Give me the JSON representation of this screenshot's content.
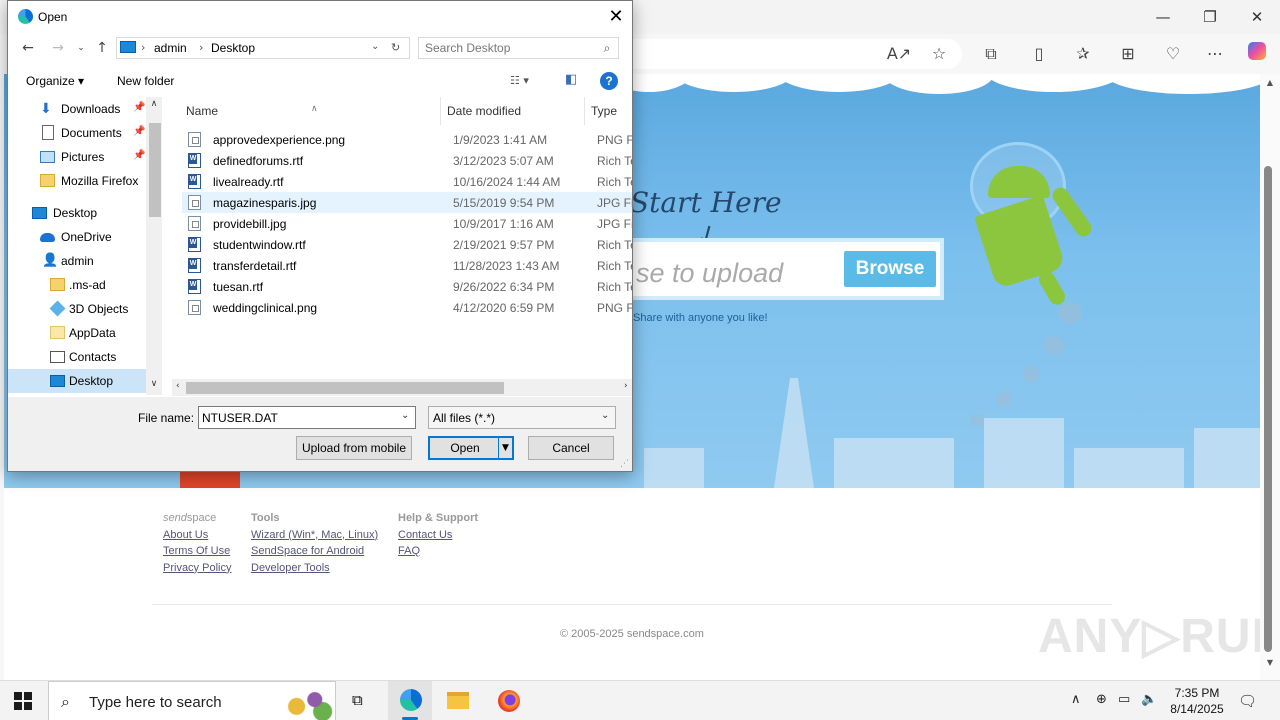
{
  "browser": {
    "window_controls": {
      "minimize": "—",
      "restore": "❐",
      "close": "✕"
    },
    "toolbar_icons": [
      "read-aloud-icon",
      "favorite-icon",
      "extensions-icon",
      "split-screen-icon",
      "favorites-icon",
      "collections-icon",
      "browser-essentials-icon",
      "more-icon",
      "copilot-icon"
    ]
  },
  "page": {
    "start_here": "Start Here",
    "upload_placeholder": "se to upload",
    "browse_label": "Browse",
    "share_text": "Share with anyone you like!",
    "footer": {
      "brand": {
        "head_a": "send",
        "head_b": "space",
        "links": [
          "About Us",
          "Terms Of Use",
          "Privacy Policy"
        ]
      },
      "tools": {
        "head": "Tools",
        "links": [
          "Wizard (Win*, Mac, Linux)",
          "SendSpace for Android",
          "Developer Tools"
        ]
      },
      "help": {
        "head": "Help & Support",
        "links": [
          "Contact Us",
          "FAQ"
        ]
      },
      "copyright": "© 2005-2025 sendspace.com"
    },
    "watermark": "ANY▷RUN"
  },
  "dialog": {
    "title": "Open",
    "breadcrumb": [
      "admin",
      "Desktop"
    ],
    "search_placeholder": "Search Desktop",
    "organize_label": "Organize ▾",
    "new_folder_label": "New folder",
    "nav_items": [
      {
        "label": "Downloads",
        "icon": "download-arrow-icon",
        "pinned": true
      },
      {
        "label": "Documents",
        "icon": "documents-icon",
        "pinned": true
      },
      {
        "label": "Pictures",
        "icon": "pictures-icon",
        "pinned": true
      },
      {
        "label": "Mozilla Firefox",
        "icon": "folder-icon",
        "pinned": false
      },
      {
        "label": "Desktop",
        "icon": "desktop-icon",
        "pinned": false
      },
      {
        "label": "OneDrive",
        "icon": "onedrive-cloud-icon",
        "pinned": false
      },
      {
        "label": "admin",
        "icon": "user-icon",
        "pinned": false
      },
      {
        "label": ".ms-ad",
        "icon": "folder-icon",
        "pinned": false
      },
      {
        "label": "3D Objects",
        "icon": "3d-objects-icon",
        "pinned": false
      },
      {
        "label": "AppData",
        "icon": "folder-icon",
        "pinned": false
      },
      {
        "label": "Contacts",
        "icon": "contacts-icon",
        "pinned": false
      },
      {
        "label": "Desktop",
        "icon": "desktop-icon",
        "pinned": false,
        "selected": true
      }
    ],
    "columns": {
      "name": "Name",
      "date": "Date modified",
      "type": "Type"
    },
    "files": [
      {
        "name": "approvedexperience.png",
        "date": "1/9/2023 1:41 AM",
        "type": "PNG File",
        "kind": "img"
      },
      {
        "name": "definedforums.rtf",
        "date": "3/12/2023 5:07 AM",
        "type": "Rich Text",
        "kind": "rtf"
      },
      {
        "name": "livealready.rtf",
        "date": "10/16/2024 1:44 AM",
        "type": "Rich Text",
        "kind": "rtf"
      },
      {
        "name": "magazinesparis.jpg",
        "date": "5/15/2019 9:54 PM",
        "type": "JPG File",
        "kind": "img",
        "highlighted": true
      },
      {
        "name": "providebill.jpg",
        "date": "10/9/2017 1:16 AM",
        "type": "JPG File",
        "kind": "img"
      },
      {
        "name": "studentwindow.rtf",
        "date": "2/19/2021 9:57 PM",
        "type": "Rich Text",
        "kind": "rtf"
      },
      {
        "name": "transferdetail.rtf",
        "date": "11/28/2023 1:43 AM",
        "type": "Rich Text",
        "kind": "rtf"
      },
      {
        "name": "tuesan.rtf",
        "date": "9/26/2022 6:34 PM",
        "type": "Rich Text",
        "kind": "rtf"
      },
      {
        "name": "weddingclinical.png",
        "date": "4/12/2020 6:59 PM",
        "type": "PNG File",
        "kind": "img"
      }
    ],
    "file_name_label": "File name:",
    "file_name_value": "NTUSER.DAT",
    "file_type_value": "All files (*.*)",
    "upload_mobile_label": "Upload from mobile",
    "open_label": "Open",
    "cancel_label": "Cancel"
  },
  "taskbar": {
    "search_placeholder": "Type here to search",
    "apps": [
      "task-view-icon",
      "edge-icon",
      "file-explorer-icon",
      "firefox-icon"
    ],
    "time": "7:35 PM",
    "date": "8/14/2025"
  }
}
